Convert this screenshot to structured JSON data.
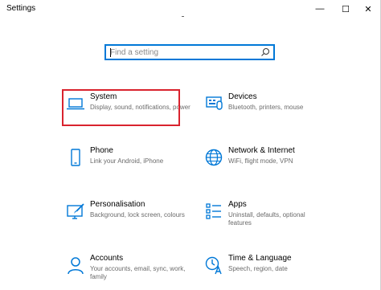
{
  "window": {
    "title": "Settings",
    "controls": {
      "minimize": "—",
      "maximize": "☐",
      "close": "✕"
    }
  },
  "search": {
    "placeholder": "Find a setting",
    "value": ""
  },
  "accent_color": "#0078d7",
  "highlight_color": "#d9232e",
  "tiles": [
    {
      "icon": "laptop-icon",
      "name": "System",
      "description": "Display, sound, notifications, power"
    },
    {
      "icon": "devices-icon",
      "name": "Devices",
      "description": "Bluetooth, printers, mouse"
    },
    {
      "icon": "phone-icon",
      "name": "Phone",
      "description": "Link your Android, iPhone"
    },
    {
      "icon": "globe-icon",
      "name": "Network & Internet",
      "description": "WiFi, flight mode, VPN"
    },
    {
      "icon": "personalisation-icon",
      "name": "Personalisation",
      "description": "Background, lock screen, colours"
    },
    {
      "icon": "apps-icon",
      "name": "Apps",
      "description": "Uninstall, defaults, optional features"
    },
    {
      "icon": "person-icon",
      "name": "Accounts",
      "description": "Your accounts, email, sync, work, family"
    },
    {
      "icon": "time-language-icon",
      "name": "Time & Language",
      "description": "Speech, region, date"
    }
  ]
}
